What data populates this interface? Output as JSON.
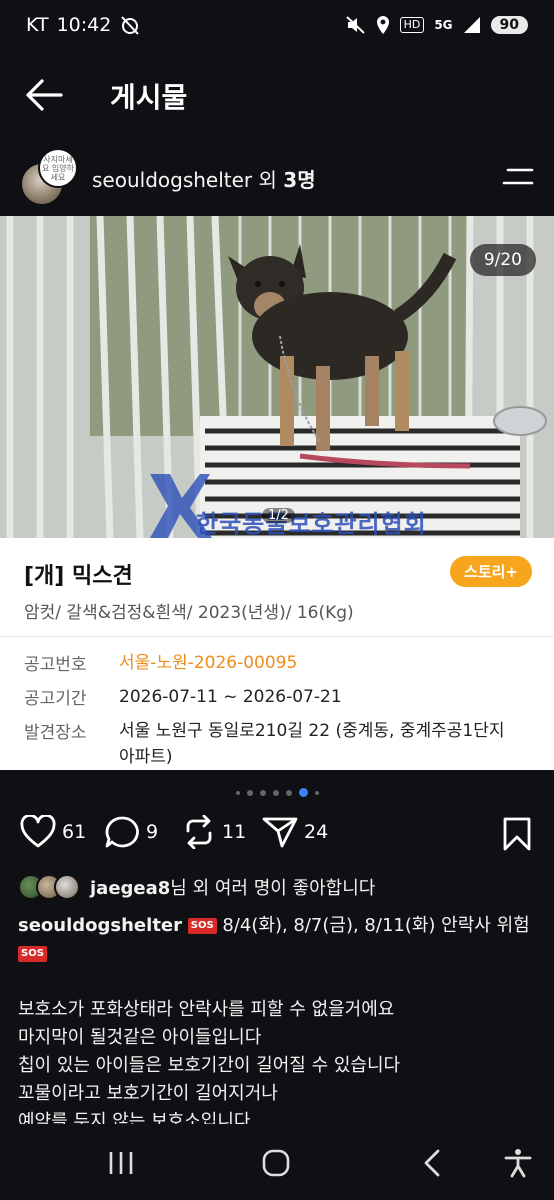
{
  "status": {
    "carrier": "KT",
    "time": "10:42",
    "hd": "HD",
    "network": "5G",
    "battery": "90"
  },
  "topbar": {
    "title": "게시물"
  },
  "post": {
    "owner": "seouldogshelter",
    "owner_suffix": "외",
    "owner_count": "3명",
    "avatar_badge_text": "사지마세요 입양하세요"
  },
  "photo": {
    "counter": "9/20",
    "sub_counter": "1/2",
    "watermark": "한국동물보호관리협회"
  },
  "card": {
    "title": "[개] 믹스견",
    "story_button": "스토리+",
    "subtitle": "암컷/ 갈색&검정&흰색/ 2023(년생)/ 16(Kg)",
    "rows": [
      {
        "key": "공고번호",
        "value": "서울-노원-2026-00095"
      },
      {
        "key": "공고기간",
        "value": "2026-07-11 ~ 2026-07-21"
      },
      {
        "key": "발견장소",
        "value": "서울 노원구 동일로210길 22 (중계동, 중계주공1단지아파트)"
      }
    ]
  },
  "actions": {
    "likes": "61",
    "comments": "9",
    "reposts": "11",
    "shares": "24"
  },
  "liked_by": {
    "user": "jaegea8",
    "text": "님 외 여러 명이 좋아합니다"
  },
  "caption": {
    "user": "seouldogshelter",
    "sos_label": "SOS",
    "headline": "8/4(화), 8/7(금), 8/11(화) 안락사 위험",
    "lines": [
      "보호소가 포화상태라 안락사를 피할 수 없을거에요",
      "마지막이 될것같은 아이들입니다",
      "칩이 있는 아이들은 보호기간이 길어질 수 있습니다",
      "꼬물이라고 보호기간이 길어지거나",
      "예약를 두지 않는 보호소입니다"
    ]
  },
  "colors": {
    "accent_orange": "#ef8c1b",
    "story_button": "#f7a51d",
    "active_dot": "#3b82f6",
    "background": "#0f1014"
  }
}
